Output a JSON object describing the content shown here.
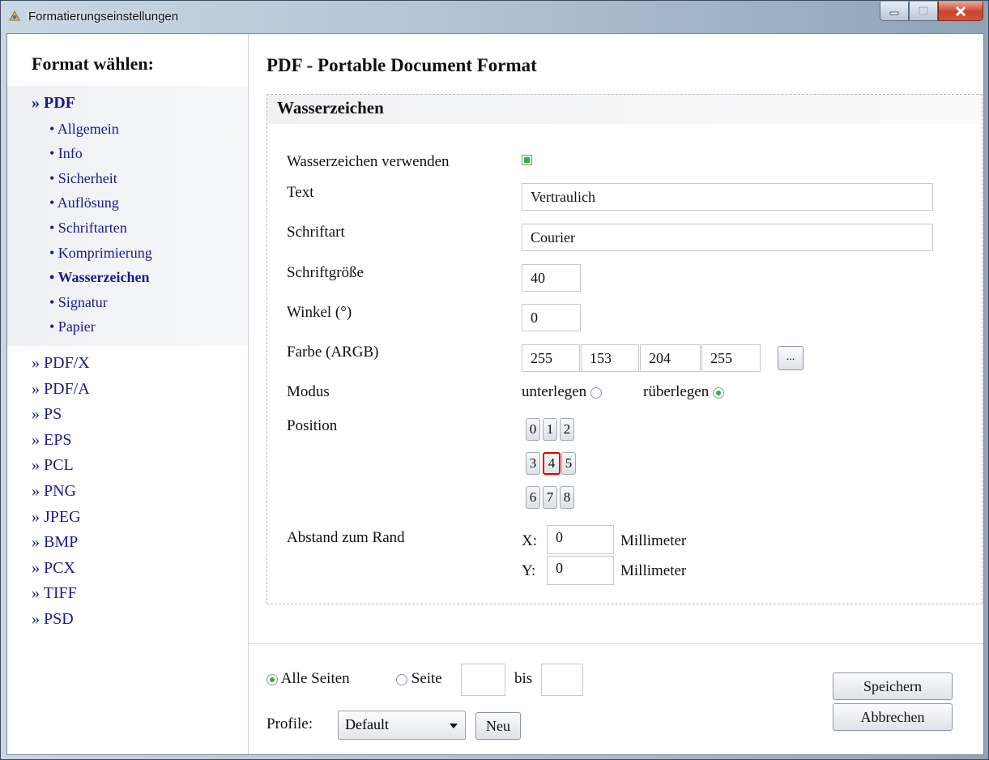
{
  "window": {
    "title": "Formatierungseinstellungen"
  },
  "sidebar": {
    "header": "Format wählen:",
    "active_format": "» PDF",
    "sub_items": [
      {
        "label": "• Allgemein"
      },
      {
        "label": "• Info"
      },
      {
        "label": "• Sicherheit"
      },
      {
        "label": "• Auflösung"
      },
      {
        "label": "• Schriftarten"
      },
      {
        "label": "• Komprimierung"
      },
      {
        "label": "• Wasserzeichen"
      },
      {
        "label": "• Signatur"
      },
      {
        "label": "• Papier"
      }
    ],
    "formats": [
      {
        "label": "» PDF/X"
      },
      {
        "label": "» PDF/A"
      },
      {
        "label": "» PS"
      },
      {
        "label": "» EPS"
      },
      {
        "label": "» PCL"
      },
      {
        "label": "» PNG"
      },
      {
        "label": "» JPEG"
      },
      {
        "label": "» BMP"
      },
      {
        "label": "» PCX"
      },
      {
        "label": "» TIFF"
      },
      {
        "label": "» PSD"
      }
    ]
  },
  "main": {
    "title": "PDF - Portable Document Format",
    "section": "Wasserzeichen",
    "use_label": "Wasserzeichen verwenden",
    "use_checked": true,
    "text_label": "Text",
    "text_value": "Vertraulich",
    "font_label": "Schriftart",
    "font_value": "Courier",
    "size_label": "Schriftgröße",
    "size_value": "40",
    "angle_label": "Winkel (°)",
    "angle_value": "0",
    "color_label": "Farbe (ARGB)",
    "color_values": [
      "255",
      "153",
      "204",
      "255"
    ],
    "color_button": "...",
    "mode_label": "Modus",
    "mode_under": "unterlegen",
    "mode_over": "rüberlegen",
    "mode_selected": "rüberlegen",
    "position_label": "Position",
    "positions": [
      "0",
      "1",
      "2",
      "3",
      "4",
      "5",
      "6",
      "7",
      "8"
    ],
    "position_selected": "4",
    "margin_label": "Abstand zum Rand",
    "x_label": "X:",
    "x_value": "0",
    "y_label": "Y:",
    "y_value": "0",
    "unit": "Millimeter"
  },
  "footer": {
    "all_pages": "Alle Seiten",
    "page": "Seite",
    "to": "bis",
    "page_from": "",
    "page_to": "",
    "profile_label": "Profile:",
    "profile_value": "Default",
    "new_button": "Neu",
    "save_button": "Speichern",
    "cancel_button": "Abbrechen"
  }
}
